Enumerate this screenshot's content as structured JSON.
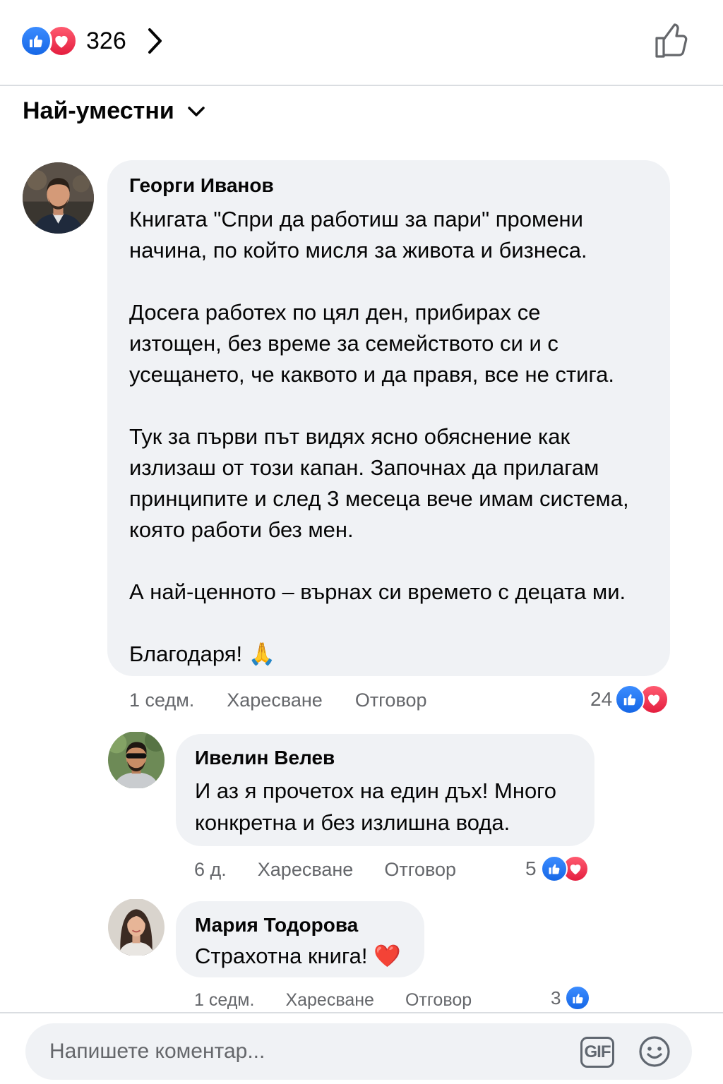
{
  "header": {
    "reaction_count": "326"
  },
  "sort": {
    "label": "Най-уместни"
  },
  "comments": [
    {
      "author": "Георги Иванов",
      "text": "Книгата \"Спри да работиш за пари\" промени\nначина, по който мисля за живота и бизнеса.\n\nДосега работех по цял ден, прибирах се\nизтощен, без време за семейството си и с\nусещането, че каквото и да правя, все не стига.\n\nТук за първи път видях ясно обяснение как\nизлизаш от този капан. Започнах да прилагам\nпринципите и след 3 месеца вече имам система,\nкоято работи без мен.\n\nА най-ценното – върнах си времето с децата ми.\n\nБлагодаря! 🙏",
      "time": "1 седм.",
      "like_label": "Харесване",
      "reply_label": "Отговор",
      "reactions_count": "24",
      "reactions": [
        "like-icon",
        "love-icon"
      ]
    },
    {
      "author": "Ивелин Велев",
      "text": "И аз я прочетох на един дъх! Много\nконкретна и без излишна вода.",
      "time": "6 д.",
      "like_label": "Харесване",
      "reply_label": "Отговор",
      "reactions_count": "5",
      "reactions": [
        "like-icon",
        "love-icon"
      ]
    },
    {
      "author": "Мария Тодорова",
      "text": "Страхотна книга! ❤️",
      "time": "1 седм.",
      "like_label": "Харесване",
      "reply_label": "Отговор",
      "reactions_count": "3",
      "reactions": [
        "like-icon"
      ]
    }
  ],
  "composer": {
    "placeholder": "Напишете коментар...",
    "gif_label": "GIF"
  },
  "colors": {
    "like_blue": "#1877f2",
    "love_red": "#e41e3f",
    "bubble_bg": "#f0f2f5",
    "secondary_text": "#65676b"
  }
}
